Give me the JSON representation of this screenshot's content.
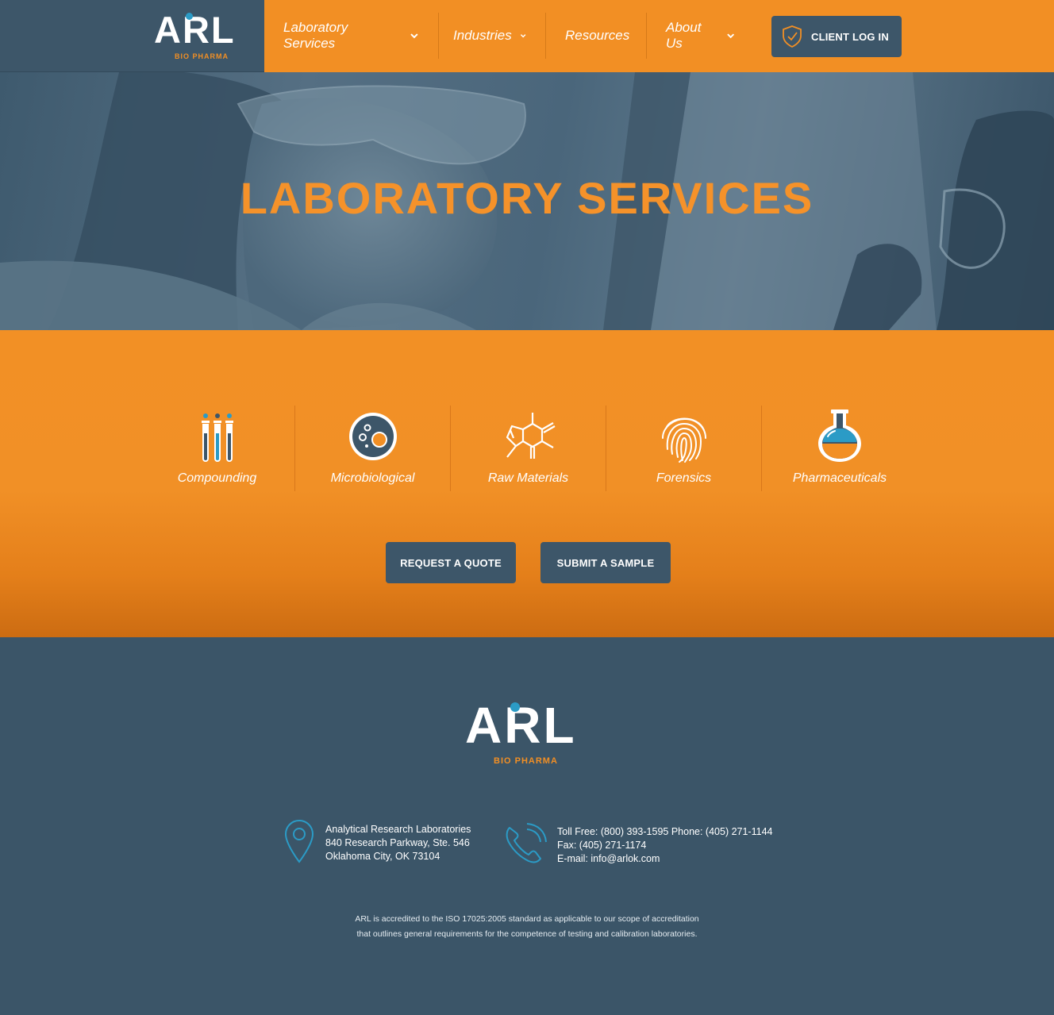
{
  "header": {
    "logo": {
      "letters": "ARL",
      "sub": "BIO PHARMA"
    },
    "nav": [
      {
        "label": "Laboratory Services",
        "has_dropdown": true
      },
      {
        "label": "Industries",
        "has_dropdown": true
      },
      {
        "label": "Resources",
        "has_dropdown": false
      },
      {
        "label": "About Us",
        "has_dropdown": true
      }
    ],
    "login_label": "CLIENT LOG IN",
    "login_icon": "shield-check-icon"
  },
  "hero": {
    "title": "LABORATORY SERVICES"
  },
  "services": {
    "items": [
      {
        "label": "Compounding",
        "icon": "test-tubes-icon"
      },
      {
        "label": "Microbiological",
        "icon": "petri-dish-icon"
      },
      {
        "label": "Raw Materials",
        "icon": "molecule-icon"
      },
      {
        "label": "Forensics",
        "icon": "fingerprint-icon"
      },
      {
        "label": "Pharmaceuticals",
        "icon": "flask-icon"
      }
    ],
    "buttons": {
      "quote": "REQUEST A QUOTE",
      "sample": "SUBMIT A SAMPLE"
    }
  },
  "footer": {
    "logo": {
      "letters": "ARL",
      "sub": "BIO PHARMA"
    },
    "address": {
      "line1": "Analytical Research Laboratories",
      "line2": "840 Research Parkway, Ste. 546",
      "line3": "Oklahoma City, OK 73104"
    },
    "contact": {
      "line1": "Toll Free: (800) 393-1595 Phone: (405) 271-1144",
      "line2": "Fax: (405) 271-1174",
      "line3": "E-mail: info@arlok.com"
    },
    "accreditation": {
      "line1": "ARL is accredited to the ISO 17025:2005 standard as applicable to our scope of accreditation",
      "line2": "that outlines general requirements for the competence of testing and calibration laboratories."
    }
  },
  "colors": {
    "orange": "#f28f24",
    "slate": "#3d5669",
    "accent_blue": "#2b9bc6"
  }
}
